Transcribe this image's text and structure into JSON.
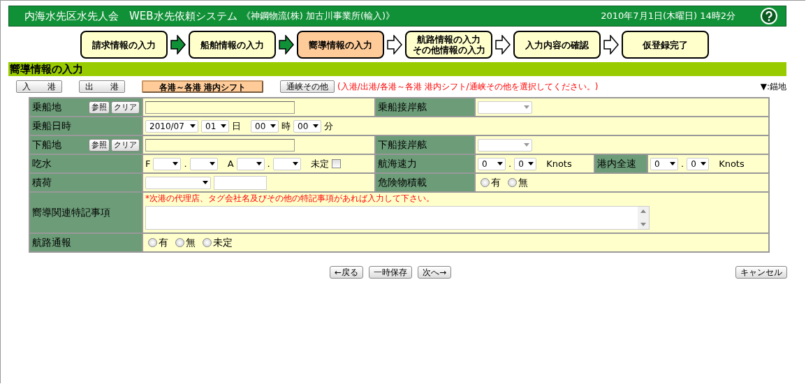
{
  "header": {
    "title": "内海水先区水先人会　WEB水先依頼システム",
    "office": "《神鋼物流(株) 加古川事業所(輸入)》",
    "datetime": "2010年7月1日(木曜日)  14時2分"
  },
  "steps": [
    {
      "lines": [
        "請求情報の入力"
      ],
      "selected": false
    },
    {
      "lines": [
        "船舶情報の入力"
      ],
      "selected": false
    },
    {
      "lines": [
        "嚮導情報の入力"
      ],
      "selected": true
    },
    {
      "lines": [
        "航路情報の入力",
        "その他情報の入力"
      ],
      "selected": false
    },
    {
      "lines": [
        "入力内容の確認"
      ],
      "selected": false
    },
    {
      "lines": [
        "仮登録完了"
      ],
      "selected": false
    }
  ],
  "step_arrows": [
    {
      "filled": true
    },
    {
      "filled": true
    },
    {
      "filled": false
    },
    {
      "filled": false
    },
    {
      "filled": false
    }
  ],
  "section_title": "嚮導情報の入力",
  "modes": [
    {
      "label": "入　　港",
      "selected": false
    },
    {
      "label": "出　　港",
      "selected": false
    },
    {
      "label": "各港～各港 港内シフト",
      "selected": true
    },
    {
      "label": "通峡その他",
      "selected": false
    }
  ],
  "mode_note": "(入港/出港/各港～各港 港内シフト/通峡その他を選択してください。)",
  "legend": "▼:錨地",
  "form": {
    "boarding_place": {
      "label": "乗船地",
      "buttons": [
        "参照",
        "クリア"
      ]
    },
    "boarding_berth": {
      "label": "乗船接岸舷"
    },
    "boarding_datetime": {
      "label": "乗船日時",
      "month": "2010/07",
      "day": "01",
      "day_unit": "日",
      "hour": "00",
      "hour_unit": "時",
      "minute": "00",
      "minute_unit": "分"
    },
    "landing_place": {
      "label": "下船地",
      "buttons": [
        "参照",
        "クリア"
      ]
    },
    "landing_berth": {
      "label": "下船接岸舷"
    },
    "draft": {
      "label": "吃水",
      "fore_label": "F",
      "fore_dot": ".",
      "aft_label": "A",
      "aft_dot": ".",
      "undecided_label": "未定",
      "undecided_checked": false
    },
    "sea_speed": {
      "label": "航海速力",
      "whole": "0",
      "dot": ".",
      "fraction": "0",
      "unit": "Knots"
    },
    "harbor_speed": {
      "label": "港内全速",
      "whole": "0",
      "dot": ".",
      "fraction": "0",
      "unit": "Knots"
    },
    "cargo": {
      "label": "積荷"
    },
    "dangerous_cargo": {
      "label": "危険物積載",
      "options": [
        {
          "label": "有",
          "selected": false
        },
        {
          "label": "無",
          "selected": false
        }
      ]
    },
    "notes": {
      "label": "嚮導関連特記事項",
      "hint": "*次港の代理店、タグ会社名及びその他の特記事項があれば入力して下さい。"
    },
    "route_report": {
      "label": "航路通報",
      "options": [
        {
          "label": "有",
          "selected": false
        },
        {
          "label": "無",
          "selected": false
        },
        {
          "label": "未定",
          "selected": false
        }
      ]
    }
  },
  "actions": [
    "←戻る",
    "一時保存",
    "次へ→"
  ],
  "cancel": "キャンセル"
}
